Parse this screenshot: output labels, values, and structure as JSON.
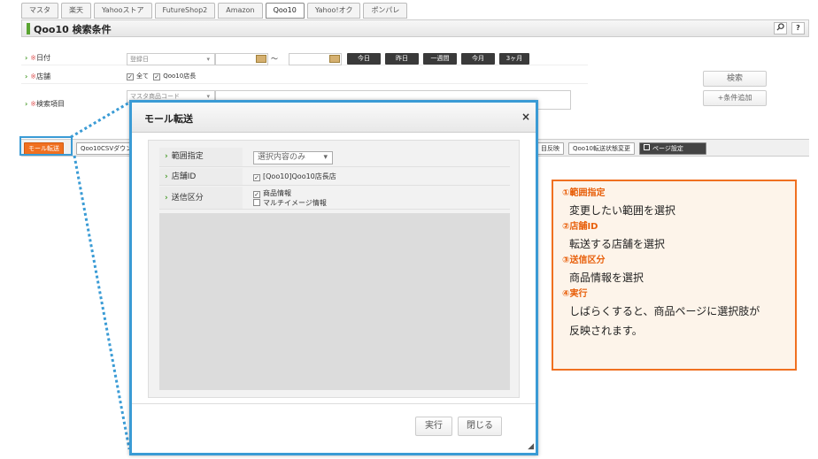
{
  "tabs": [
    "マスタ",
    "楽天",
    "Yahooストア",
    "FutureShop2",
    "Amazon",
    "Qoo10",
    "Yahoo!オク",
    "ポンパレ"
  ],
  "header": {
    "title": "Qoo10 検索条件",
    "btn_search_icon": "search-icon",
    "btn_help": "?"
  },
  "form": {
    "date_label": "日付",
    "date_select": "登録日",
    "date_tilde": "〜",
    "date_buttons": [
      "今日",
      "昨日",
      "一週間",
      "今月",
      "3ヶ月"
    ],
    "shop_label": "店舗",
    "shop_all": "全て",
    "shop_qoo10": "Qoo10店長",
    "item_label": "検索項目",
    "item_select": "マスタ商品コード",
    "search_button": "検索",
    "add_condition_button": "+条件追加",
    "asterisk": "※"
  },
  "actionbar": {
    "mall_transfer": "モール転送",
    "csv_download": "Qoo10CSVダウン",
    "reflect": "目反映",
    "status_change": "Qoo10転送状態変更",
    "page_settings": "ページ設定"
  },
  "modal": {
    "title": "モール転送",
    "close": "×",
    "range_label": "範囲指定",
    "range_value": "選択内容のみ",
    "shop_id_label": "店舗ID",
    "shop_id_value": "[Qoo10]Qoo10店長店",
    "send_label": "送信区分",
    "send_item1": "商品情報",
    "send_item2": "マルチイメージ情報",
    "run_button": "実行",
    "close_button": "閉じる"
  },
  "note": {
    "h1": "①範囲指定",
    "d1": "変更したい範囲を選択",
    "h2": "②店舗ID",
    "d2": "転送する店舗を選択",
    "h3": "③送信区分",
    "d3": "商品情報を選択",
    "h4": "④実行",
    "d4a": "しばらくすると、商品ページに選択肢が",
    "d4b": "反映されます。"
  },
  "colors": {
    "accent_blue": "#3a9bd5",
    "accent_orange": "#f07020",
    "green": "#5aa431"
  }
}
